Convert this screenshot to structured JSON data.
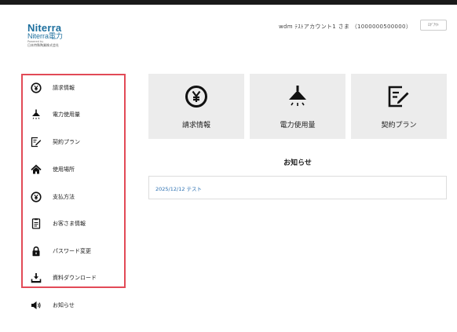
{
  "brand": {
    "name": "Niterra",
    "sub": "Niterra電力",
    "powered_by": "Powered by",
    "corp": "日本特殊陶業株式会社",
    "color": "#1d6f9e"
  },
  "header": {
    "user": "wdm ﾃｽﾄアカウント1 さま （1000000500000）",
    "logout_label": "ﾛｸﾞｱｳﾄ"
  },
  "sidebar": {
    "highlight_color": "#e24a57",
    "items": [
      {
        "label": "請求情報",
        "icon": "yen-circle-icon"
      },
      {
        "label": "電力使用量",
        "icon": "lamp-icon"
      },
      {
        "label": "契約プラン",
        "icon": "contract-edit-icon"
      },
      {
        "label": "使用場所",
        "icon": "home-icon"
      },
      {
        "label": "支払方法",
        "icon": "yen-circle-icon"
      },
      {
        "label": "お客さま情報",
        "icon": "document-icon"
      },
      {
        "label": "パスワード変更",
        "icon": "lock-icon"
      },
      {
        "label": "資料ダウンロード",
        "icon": "download-icon"
      },
      {
        "label": "お知らせ",
        "icon": "speaker-icon"
      }
    ]
  },
  "tiles": [
    {
      "label": "請求情報",
      "icon": "yen-circle-icon"
    },
    {
      "label": "電力使用量",
      "icon": "lamp-icon"
    },
    {
      "label": "契約プラン",
      "icon": "contract-edit-icon"
    }
  ],
  "notices": {
    "title": "お知らせ",
    "items": [
      {
        "text": "2025/12/12 テスト"
      }
    ]
  }
}
